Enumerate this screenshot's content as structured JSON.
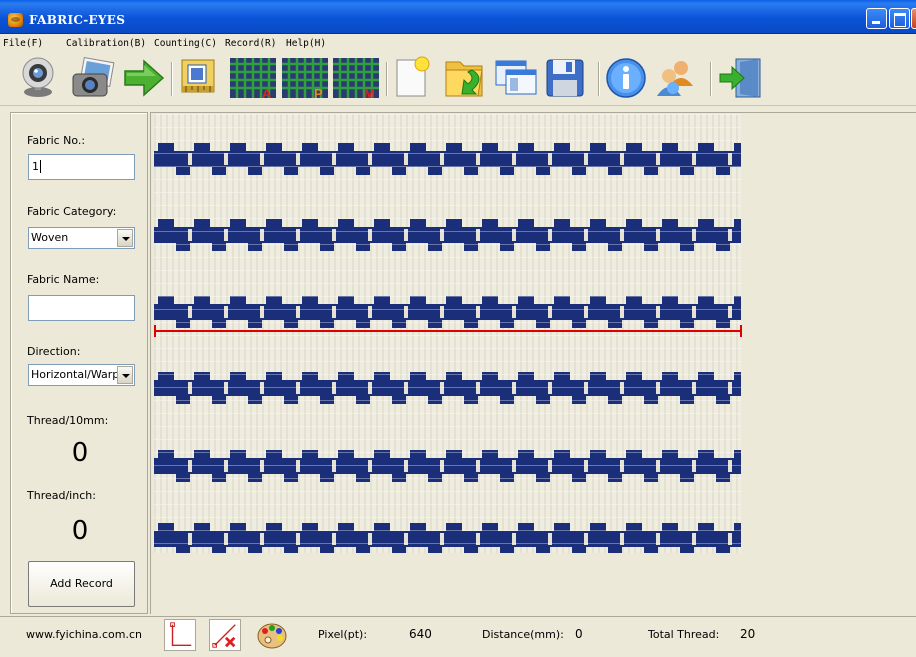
{
  "window": {
    "title": "FABRIC-EYES"
  },
  "menu": [
    {
      "label": "File(F)"
    },
    {
      "label": "Calibration(B)"
    },
    {
      "label": "Counting(C)"
    },
    {
      "label": "Record(R)"
    },
    {
      "label": "Help(H)"
    }
  ],
  "toolbar": {
    "icons": [
      "webcam-icon",
      "photos-icon",
      "forward-arrow-icon",
      "calibrate-icon",
      "count-a-icon",
      "count-p-icon",
      "count-m-icon",
      "new-file-icon",
      "open-folder-icon",
      "windows-icon",
      "save-disk-icon",
      "info-icon",
      "users-icon",
      "exit-door-icon"
    ],
    "grid_letters": [
      "A",
      "P",
      "M"
    ]
  },
  "left_panel": {
    "fabric_no_label": "Fabric No.:",
    "fabric_no_value": "1",
    "fabric_category_label": "Fabric Category:",
    "fabric_category_value": "Woven",
    "fabric_name_label": "Fabric Name:",
    "fabric_name_value": "",
    "direction_label": "Direction:",
    "direction_value": "Horizontal/Warp",
    "thread_10mm_label": "Thread/10mm:",
    "thread_10mm_value": "0",
    "thread_inch_label": "Thread/inch:",
    "thread_inch_value": "0",
    "add_record_label": "Add Record"
  },
  "status": {
    "website": "www.fyichina.com.cn",
    "pixel_label": "Pixel(pt):",
    "pixel_value": "640",
    "distance_label": "Distance(mm):",
    "distance_value": "0",
    "total_thread_label": "Total Thread:",
    "total_thread_value": "20"
  },
  "colors": {
    "title_bar": "#0b54d8",
    "fabric_blue": "#1a2e7a",
    "fabric_white": "#efece0",
    "measure_line": "#e10000"
  }
}
